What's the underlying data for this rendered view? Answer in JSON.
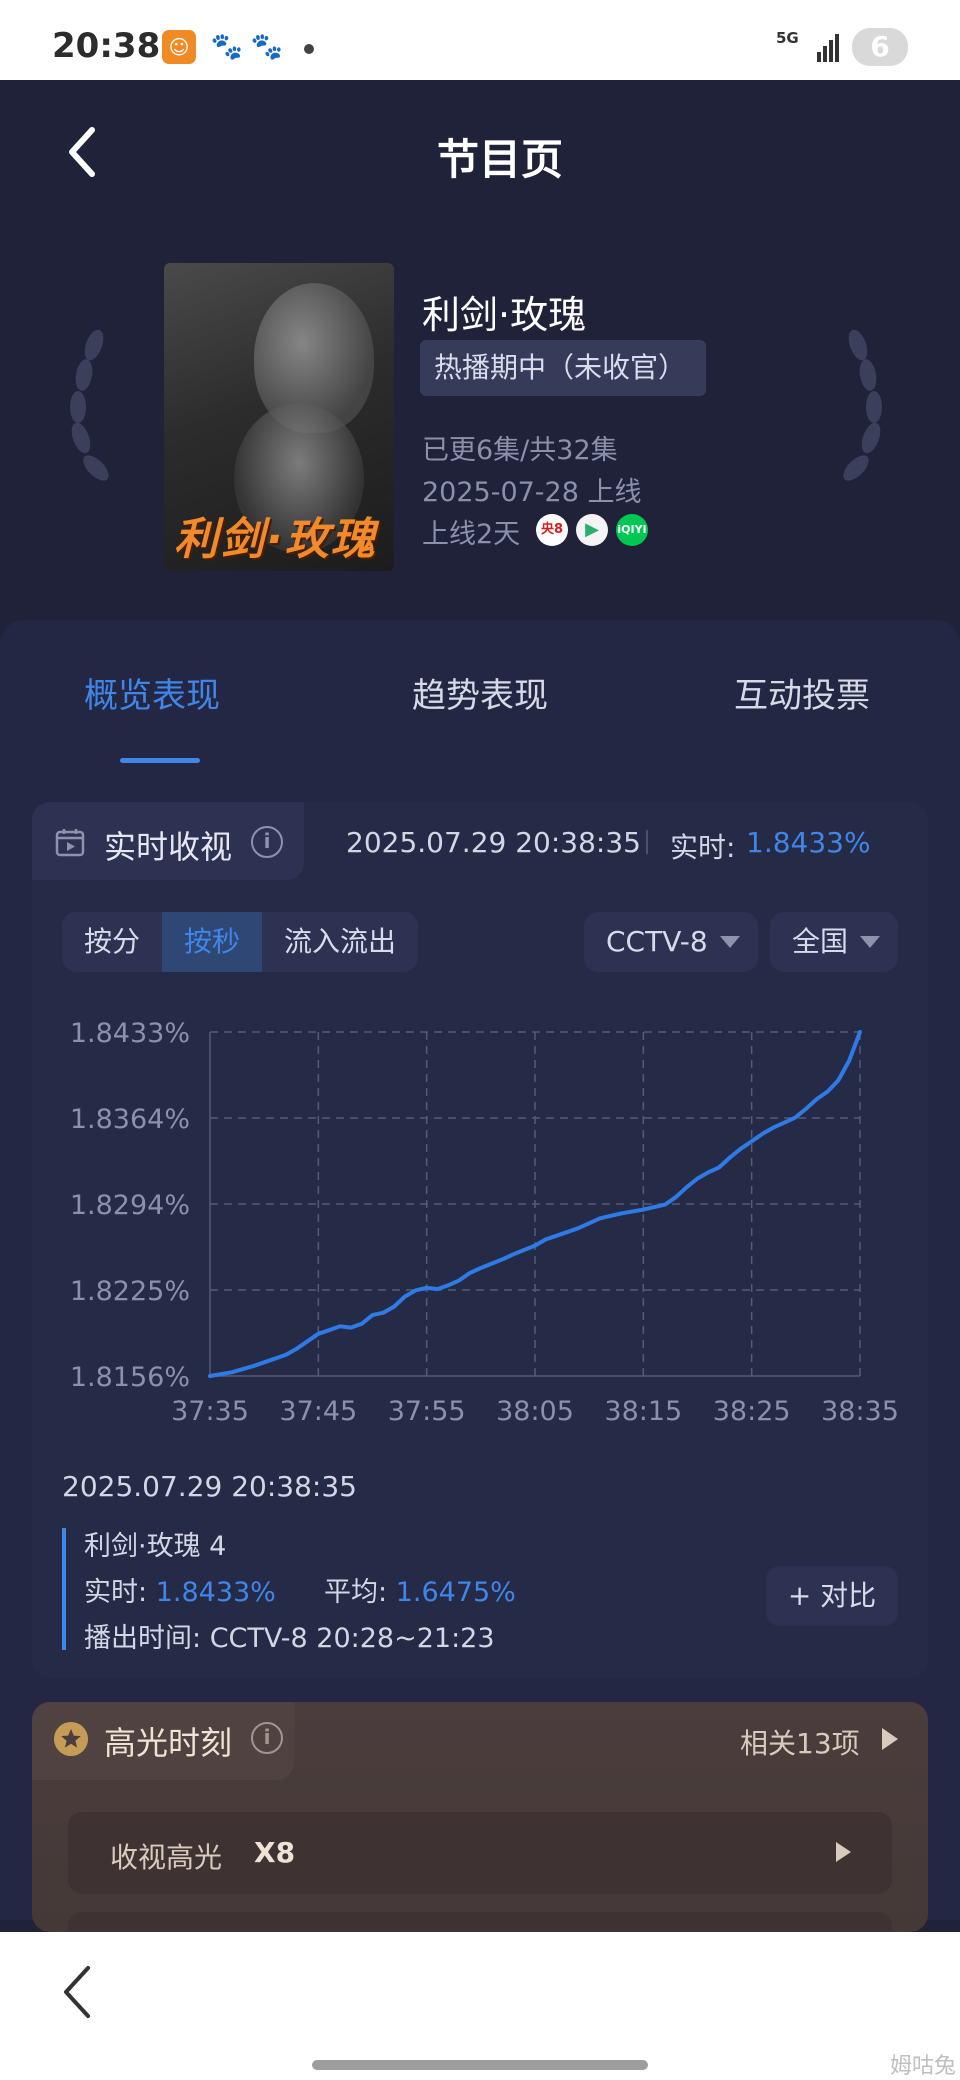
{
  "status_bar": {
    "time": "20:38",
    "network": "5G",
    "battery": "6"
  },
  "header": {
    "title": "节目页",
    "back_icon": "chevron-left-icon"
  },
  "program": {
    "name": "利剑·玫瑰",
    "poster_title": "利剑·玫瑰",
    "status": "热播期中（未收官）",
    "episodes": "已更6集/共32集",
    "premiere": "2025-07-28 上线",
    "days_online": "上线2天",
    "platforms": [
      "央8",
      "▶",
      "iQIYI"
    ]
  },
  "tabs": [
    {
      "label": "概览表现",
      "active": true
    },
    {
      "label": "趋势表现",
      "active": false
    },
    {
      "label": "互动投票",
      "active": false
    }
  ],
  "realtime": {
    "label": "实时收视",
    "timestamp": "2025.07.29 20:38:35",
    "now_label": "实时:",
    "now_value": "1.8433%",
    "modes": [
      "按分",
      "按秒",
      "流入流出"
    ],
    "active_mode": "按秒",
    "channel": "CCTV-8",
    "region": "全国"
  },
  "chart_data": {
    "type": "line",
    "x_ticks": [
      "37:35",
      "37:45",
      "37:55",
      "38:05",
      "38:15",
      "38:25",
      "38:35"
    ],
    "y_ticks": [
      "1.8433%",
      "1.8364%",
      "1.8294%",
      "1.8225%",
      "1.8156%"
    ],
    "ylim": [
      1.8156,
      1.8433
    ],
    "x_seconds_range": [
      0,
      60
    ],
    "grid": true,
    "series": [
      {
        "color": "#2f7be6",
        "points": [
          [
            0,
            1.8156
          ],
          [
            2,
            1.8159
          ],
          [
            4,
            1.8164
          ],
          [
            5,
            1.8167
          ],
          [
            7,
            1.8173
          ],
          [
            8,
            1.8178
          ],
          [
            10,
            1.819
          ],
          [
            11,
            1.8193
          ],
          [
            12,
            1.8196
          ],
          [
            13,
            1.8195
          ],
          [
            14,
            1.8198
          ],
          [
            15,
            1.8205
          ],
          [
            16,
            1.8207
          ],
          [
            17,
            1.8212
          ],
          [
            18,
            1.822
          ],
          [
            19,
            1.8225
          ],
          [
            20,
            1.8227
          ],
          [
            21,
            1.8226
          ],
          [
            22,
            1.8229
          ],
          [
            23,
            1.8233
          ],
          [
            24,
            1.8239
          ],
          [
            25,
            1.8243
          ],
          [
            27,
            1.825
          ],
          [
            28,
            1.8254
          ],
          [
            30,
            1.8261
          ],
          [
            31,
            1.8266
          ],
          [
            32,
            1.8269
          ],
          [
            34,
            1.8275
          ],
          [
            36,
            1.8283
          ],
          [
            38,
            1.8287
          ],
          [
            40,
            1.829
          ],
          [
            41,
            1.8292
          ],
          [
            42,
            1.8294
          ],
          [
            43,
            1.83
          ],
          [
            44,
            1.8308
          ],
          [
            45,
            1.8315
          ],
          [
            46,
            1.832
          ],
          [
            47,
            1.8324
          ],
          [
            48,
            1.8332
          ],
          [
            49,
            1.8339
          ],
          [
            50,
            1.8345
          ],
          [
            51,
            1.8351
          ],
          [
            52,
            1.8356
          ],
          [
            53,
            1.836
          ],
          [
            54,
            1.8364
          ],
          [
            55,
            1.8371
          ],
          [
            56,
            1.8379
          ],
          [
            57,
            1.8385
          ],
          [
            58,
            1.8394
          ],
          [
            59,
            1.841
          ],
          [
            60,
            1.8433
          ]
        ]
      }
    ]
  },
  "detail": {
    "time": "2025.07.29 20:38:35",
    "episode": "利剑·玫瑰 4",
    "now_label": "实时:",
    "now_value": "1.8433%",
    "avg_label": "平均:",
    "avg_value": "1.6475%",
    "broadcast_label": "播出时间:",
    "broadcast_value": "CCTV-8 20:28~21:23",
    "compare_label": "+ 对比"
  },
  "highlights": {
    "label": "高光时刻",
    "count": "相关13项",
    "rows": [
      {
        "label": "收视高光",
        "value": "X8"
      }
    ]
  },
  "watermark": "姆咕兔"
}
